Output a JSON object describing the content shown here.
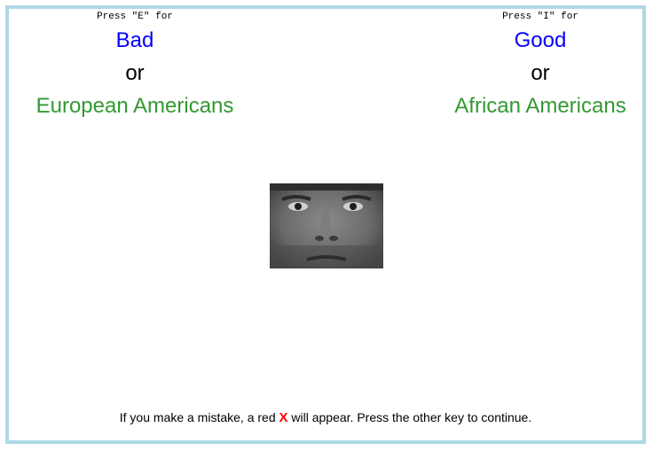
{
  "left": {
    "press_text": "Press \"E\" for",
    "attribute": "Bad",
    "connector": "or",
    "group": "European Americans"
  },
  "right": {
    "press_text": "Press \"I\" for",
    "attribute": "Good",
    "connector": "or",
    "group": "African Americans"
  },
  "footer": {
    "before": "If you make a mistake, a red ",
    "mark": "X",
    "after": " will appear. Press the other key to continue."
  },
  "colors": {
    "attribute": "#0000ff",
    "group": "#339933",
    "error_mark": "#ff0000",
    "border": "#add8e6"
  }
}
